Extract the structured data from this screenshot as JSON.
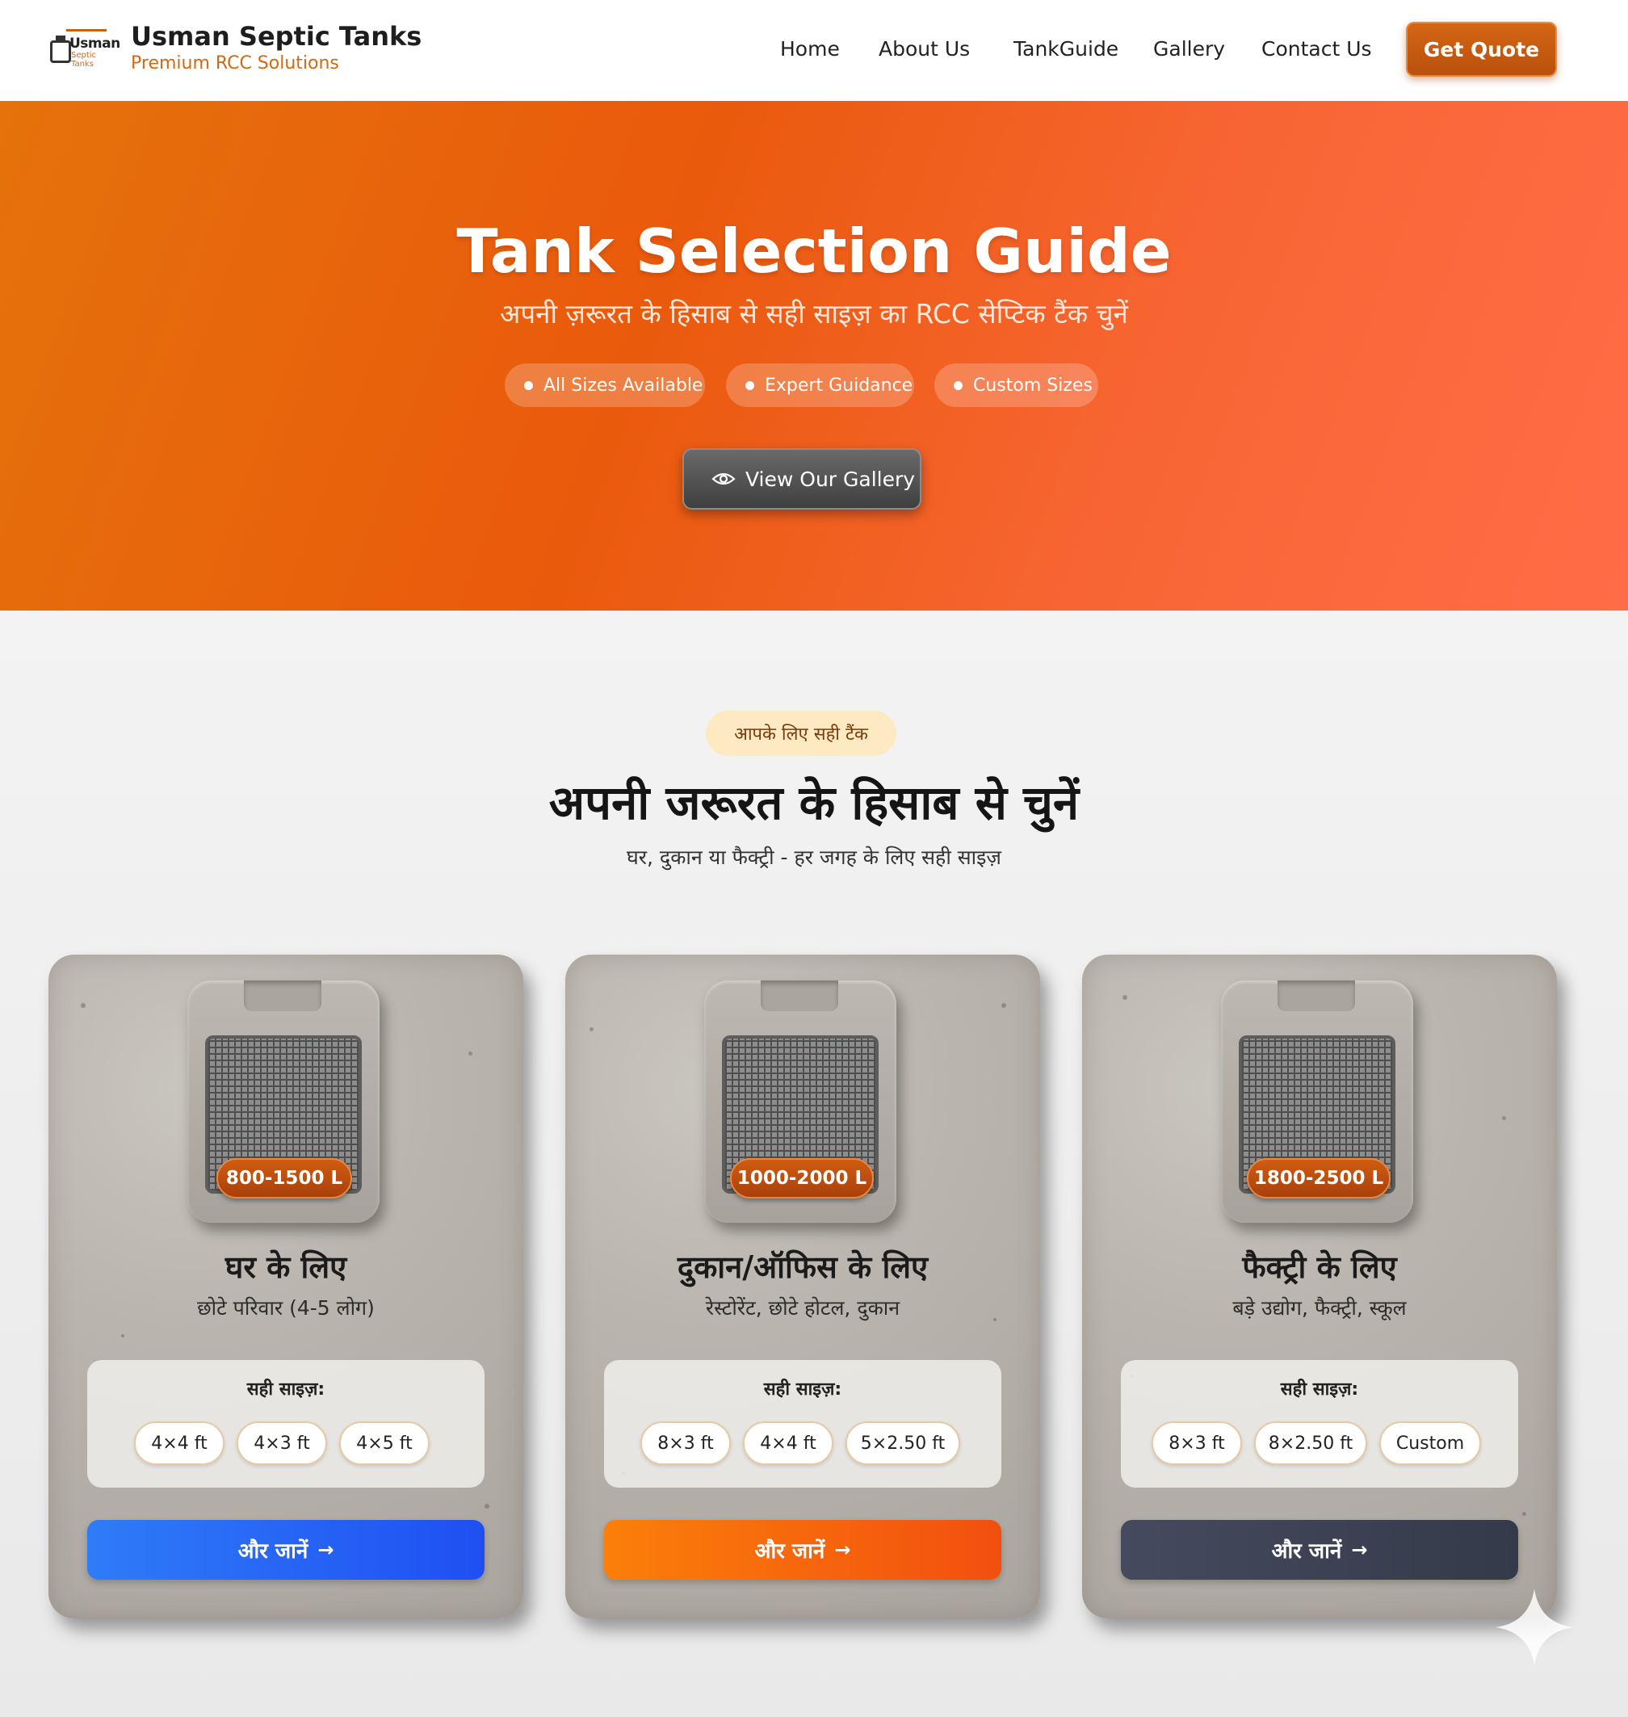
{
  "header": {
    "logo_text": "Usman",
    "logo_subtext": "Septic Tanks",
    "brand_title": "Usman Septic Tanks",
    "brand_subtitle": "Premium RCC Solutions",
    "nav": [
      "Home",
      "About Us",
      "TankGuide",
      "Gallery",
      "Contact Us"
    ],
    "cta": "Get Quote"
  },
  "hero": {
    "title": "Tank Selection Guide",
    "subtitle": "अपनी ज़रूरत के हिसाब से सही साइज़ का RCC सेप्टिक टैंक चुनें",
    "pills": [
      "All Sizes Available",
      "Expert Guidance",
      "Custom Sizes"
    ],
    "gallery_button": "View Our Gallery"
  },
  "section": {
    "tag": "आपके लिए सही टैंक",
    "title": "अपनी जरूरत के हिसाब से चुनें",
    "subtitle": "घर, दुकान या फैक्ट्री - हर जगह के लिए सही साइज़"
  },
  "cards": [
    {
      "capacity": "800-1500 L",
      "title": "घर के लिए",
      "subtitle": "छोटे परिवार (4-5 लोग)",
      "sizes_label": "सही साइज़:",
      "sizes": [
        "4×4 ft",
        "4×3 ft",
        "4×5 ft"
      ],
      "button": "और जानें",
      "button_color": "#2b6cf6"
    },
    {
      "capacity": "1000-2000 L",
      "title": "दुकान/ऑफिस के लिए",
      "subtitle": "रेस्टोरेंट, छोटे होटल, दुकान",
      "sizes_label": "सही साइज़:",
      "sizes": [
        "8×3 ft",
        "4×4 ft",
        "5×2.50 ft"
      ],
      "button": "और जानें",
      "button_color": "#f26a0f"
    },
    {
      "capacity": "1800-2500 L",
      "title": "फैक्ट्री के लिए",
      "subtitle": "बड़े उद्योग, फैक्ट्री, स्कूल",
      "sizes_label": "सही साइज़:",
      "sizes": [
        "8×3 ft",
        "8×2.50 ft",
        "Custom"
      ],
      "button": "और जानें",
      "button_color": "#3f4658"
    }
  ],
  "colors": {
    "accent": "#d06a14",
    "hero_start": "#e5720b",
    "hero_end": "#ff6d48"
  }
}
